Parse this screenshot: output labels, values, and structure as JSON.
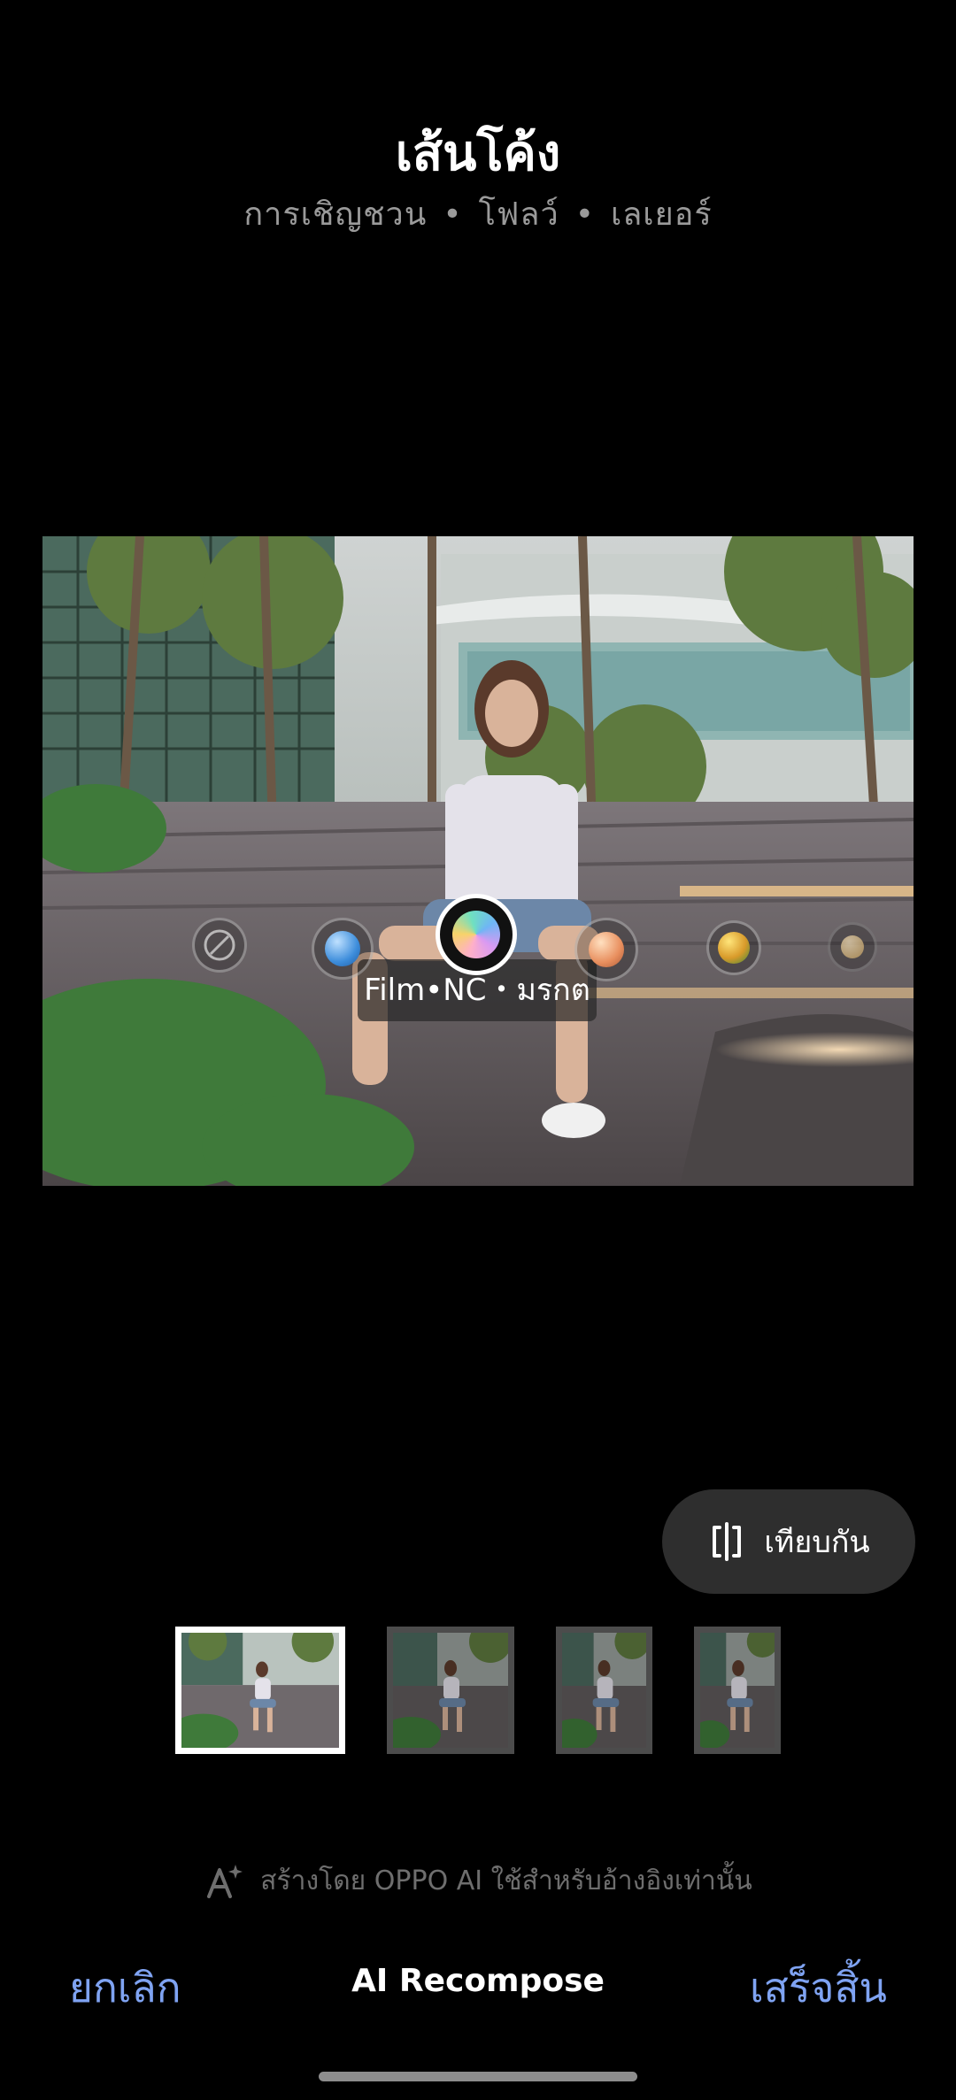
{
  "header": {
    "title": "เส้นโค้ง",
    "subtitle_items": [
      "การเชิญชวน",
      "โฟลว์",
      "เลเยอร์"
    ]
  },
  "preview": {
    "filter_label": "Film•NC・มรกต",
    "filters": [
      {
        "icon": "none-icon",
        "selected": false
      },
      {
        "icon": "blue-filter-icon",
        "color": "#4a9be0",
        "selected": false
      },
      {
        "icon": "rainbow-filter-icon",
        "selected": true
      },
      {
        "icon": "peach-filter-icon",
        "color": "#e89a6a",
        "selected": false
      },
      {
        "icon": "yellow-green-filter-icon",
        "color": "#c7b030",
        "selected": false
      },
      {
        "icon": "faded-filter-icon",
        "color": "#d9b37a",
        "selected": false
      }
    ]
  },
  "compare": {
    "label": "เทียบกัน",
    "icon": "compare-icon"
  },
  "thumbnails": {
    "count": 4,
    "selected_index": 0
  },
  "ai_note": {
    "icon": "ai-sparkle-icon",
    "text": "สร้างโดย OPPO AI ใช้สำหรับอ้างอิงเท่านั้น"
  },
  "bottom": {
    "cancel": "ยกเลิก",
    "mode": "AI Recompose",
    "done": "เสร็จสิ้น"
  },
  "colors": {
    "accent": "#7fa3f2",
    "background": "#000000"
  }
}
